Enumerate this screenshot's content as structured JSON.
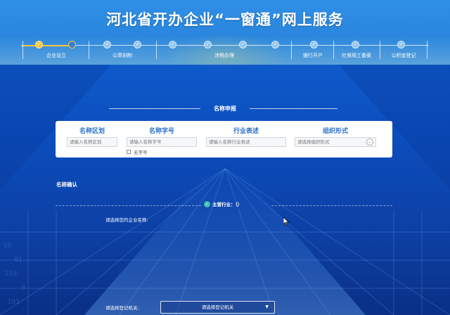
{
  "header": {
    "title": "河北省开办企业“一窗通”网上服务"
  },
  "steps": [
    {
      "label": "企业设立"
    },
    {
      "label": "公章刻制"
    },
    {
      "label": "涉税办理"
    },
    {
      "label": "银行开户"
    },
    {
      "label": "社保用工备案"
    },
    {
      "label": "公积金登记"
    }
  ],
  "step_icons": {
    "completed": "check-icon"
  },
  "section": {
    "title": "名称申报"
  },
  "form": {
    "region": {
      "label": "名称区划",
      "placeholder": "请输入名称区划"
    },
    "name": {
      "label": "名称字号",
      "placeholder": "请输入名称字号"
    },
    "industry": {
      "label": "行业表述",
      "placeholder": "请输入名称行业表述"
    },
    "org": {
      "label": "组织形式",
      "placeholder": "请选择组织形式"
    },
    "no_name_label": "无字号"
  },
  "confirm": {
    "title": "名称确认",
    "main_industry": "主营行业：（）",
    "choose_name_label": "请选择您的企业名称:",
    "choose_org_label": "请选择登记机关:",
    "org_select_placeholder": "请选择登记机关"
  },
  "colors": {
    "accent": "#2a6fc9",
    "step_active": "#f5c53a",
    "check": "#40c0b0"
  }
}
